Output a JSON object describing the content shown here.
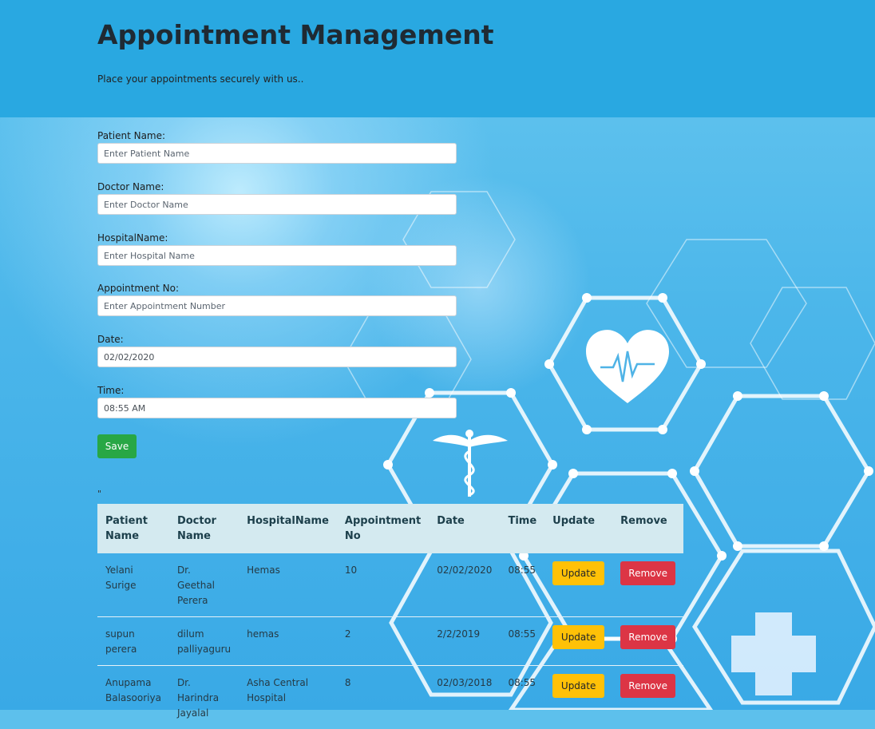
{
  "header": {
    "title": "Appointment Management",
    "lead": "Place your appointments securely with us.."
  },
  "form": {
    "patient": {
      "label": "Patient Name:",
      "placeholder": "Enter Patient Name",
      "value": ""
    },
    "doctor": {
      "label": "Doctor Name:",
      "placeholder": "Enter Doctor Name",
      "value": ""
    },
    "hospital": {
      "label": "HospitalName:",
      "placeholder": "Enter Hospital Name",
      "value": ""
    },
    "appno": {
      "label": "Appointment No:",
      "placeholder": "Enter Appointment Number",
      "value": ""
    },
    "date": {
      "label": "Date:",
      "value": "02/02/2020"
    },
    "time": {
      "label": "Time:",
      "value": "08:55 AM"
    },
    "save_label": "Save"
  },
  "stray_text": "\"",
  "table": {
    "headers": [
      "Patient Name",
      "Doctor Name",
      "HospitalName",
      "Appointment No",
      "Date",
      "Time",
      "Update",
      "Remove"
    ],
    "rows": [
      {
        "patient": "Yelani Surige",
        "doctor": "Dr. Geethal Perera",
        "hospital": "Hemas",
        "appno": "10",
        "date": "02/02/2020",
        "time": "08:55",
        "update": "Update",
        "remove": "Remove"
      },
      {
        "patient": "supun perera",
        "doctor": "dilum palliyaguru",
        "hospital": "hemas",
        "appno": "2",
        "date": "2/2/2019",
        "time": "08:55",
        "update": "Update",
        "remove": "Remove"
      },
      {
        "patient": "Anupama Balasooriya",
        "doctor": "Dr. Harindra Jayalal",
        "hospital": "Asha Central Hospital",
        "appno": "8",
        "date": "02/03/2018",
        "time": "08:55",
        "update": "Update",
        "remove": "Remove"
      }
    ]
  },
  "colors": {
    "header_bg": "#29a8e1",
    "save": "#28a745",
    "update": "#ffc107",
    "remove": "#dc3545",
    "table_head": "#d4eaf0"
  },
  "background_icons": [
    "hexagon-network",
    "heart-pulse-icon",
    "caduceus-icon",
    "medical-cross-icon"
  ]
}
